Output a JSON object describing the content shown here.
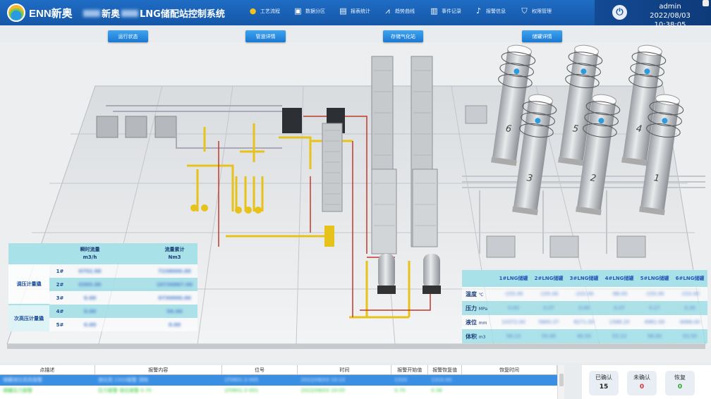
{
  "header": {
    "brand": "ENN新奥",
    "title_prefix": "新奥",
    "title_main": "LNG储配站控制系统",
    "nav": [
      {
        "label": "工艺流程",
        "icon": "process-icon"
      },
      {
        "label": "数据分区",
        "icon": "data-icon"
      },
      {
        "label": "报表统计",
        "icon": "report-icon"
      },
      {
        "label": "趋势曲线",
        "icon": "trend-icon"
      },
      {
        "label": "事件记录",
        "icon": "event-icon"
      },
      {
        "label": "报警信息",
        "icon": "alarm-icon"
      },
      {
        "label": "权限管理",
        "icon": "shield-icon"
      }
    ],
    "user": "admin",
    "datetime": "2022/08/03 10:38:05"
  },
  "buttons": [
    "运行状态",
    "管道详情",
    "存储气化站",
    "储罐详情"
  ],
  "flow_table": {
    "headers": [
      "瞬时流量",
      "m3/h",
      "流量累计",
      "Nm3"
    ],
    "groups": [
      "调压计量撬",
      "次高压计量撬"
    ],
    "rows": [
      {
        "no": "1#",
        "flow": "0752.00",
        "total": "7238000.00"
      },
      {
        "no": "2#",
        "flow": "0365.00",
        "total": "10730867.00"
      },
      {
        "no": "3#",
        "flow": "0.00",
        "total": "0730000.00"
      },
      {
        "no": "4#",
        "flow": "0.00",
        "total": "56.00"
      },
      {
        "no": "5#",
        "flow": "0.00",
        "total": "0.00"
      }
    ]
  },
  "tank_table": {
    "headers": [
      "1#LNG储罐",
      "2#LNG储罐",
      "3#LNG储罐",
      "4#LNG储罐",
      "5#LNG储罐",
      "6#LNG储罐"
    ],
    "rows": [
      {
        "label": "温度",
        "unit": "℃",
        "values": [
          "-155.00",
          "-155.00",
          "-153.00",
          "-98.00",
          "-155.00",
          "-153.00"
        ]
      },
      {
        "label": "压力",
        "unit": "MPa",
        "values": [
          "0.00",
          "0.07",
          "0.09",
          "0.07",
          "0.27",
          "0.30"
        ]
      },
      {
        "label": "液位",
        "unit": "mm",
        "values": [
          "10372.00",
          "5800.37",
          "8271.00",
          "1588.20",
          "4961.00",
          "4088.00"
        ]
      },
      {
        "label": "体积",
        "unit": "m3",
        "values": [
          "58.13",
          "55.00",
          "40.50",
          "53.13",
          "58.00",
          "53.50"
        ]
      }
    ]
  },
  "tanks": [
    "6",
    "5",
    "4",
    "3",
    "2",
    "1"
  ],
  "alarm_table": {
    "headers": [
      "点描述",
      "报警内容",
      "位号",
      "时间",
      "报警开始值",
      "报警恢复值",
      "恢复时间"
    ],
    "rows": [
      [
        "储罐液位高高报警",
        "液位高 1310报警 消除",
        "LT0801-2-005",
        "2022/08/03 10:10",
        "1310",
        "1310.00",
        ""
      ],
      [
        "储罐压力报警",
        "压力报警 液位报警 0.70",
        "LT0801-2-001",
        "2022/08/03 10:05",
        "0.70",
        "0.38",
        ""
      ]
    ]
  },
  "stats": [
    {
      "label": "已确认",
      "value": "15",
      "color": "#222222"
    },
    {
      "label": "未确认",
      "value": "0",
      "color": "#e03030"
    },
    {
      "label": "恢复",
      "value": "0",
      "color": "#2aa52a"
    }
  ]
}
